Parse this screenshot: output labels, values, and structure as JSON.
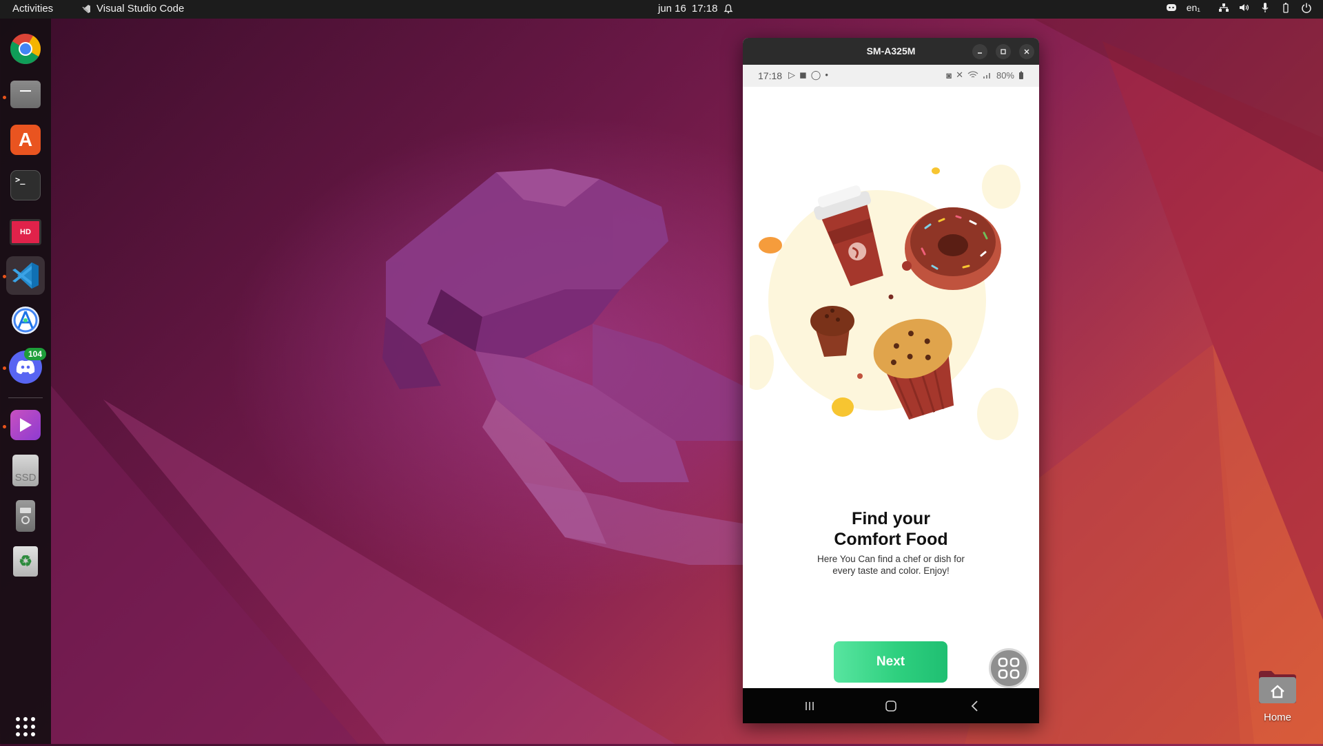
{
  "topbar": {
    "activities": "Activities",
    "app_name": "Visual Studio Code",
    "date": "jun 16",
    "time": "17:18",
    "input_lang": "en₁"
  },
  "dock": {
    "items": [
      {
        "name": "Google Chrome",
        "icon": "chrome-icon"
      },
      {
        "name": "Files",
        "icon": "files-icon"
      },
      {
        "name": "Ubuntu Software",
        "icon": "app-store-icon"
      },
      {
        "name": "Terminal",
        "icon": "terminal-icon"
      },
      {
        "name": "Screen Recorder",
        "icon": "screen-recorder-icon"
      },
      {
        "name": "Visual Studio Code",
        "icon": "vscode-icon"
      },
      {
        "name": "Android Studio",
        "icon": "android-studio-icon"
      },
      {
        "name": "Discord",
        "icon": "discord-icon",
        "badge": "104"
      },
      {
        "name": "Video Player",
        "icon": "video-player-icon"
      },
      {
        "name": "SSD",
        "icon": "ssd-drive-icon",
        "label": "SSD"
      },
      {
        "name": "External Drive",
        "icon": "usb-drive-icon"
      },
      {
        "name": "Trash",
        "icon": "trash-icon"
      },
      {
        "name": "Show Applications",
        "icon": "app-grid-icon"
      }
    ]
  },
  "phone_window": {
    "title": "SM-A325M",
    "status_bar": {
      "time": "17:18",
      "battery": "80%"
    },
    "onboarding": {
      "headline_line1": "Find your",
      "headline_line2": "Comfort Food",
      "subtext_line1": "Here You Can find a chef or dish for",
      "subtext_line2": "every taste and color. Enjoy!",
      "next_label": "Next"
    },
    "colors": {
      "button_green": "#2fd07f",
      "blob": "#fdf6dc"
    }
  },
  "desktop": {
    "home_label": "Home"
  }
}
